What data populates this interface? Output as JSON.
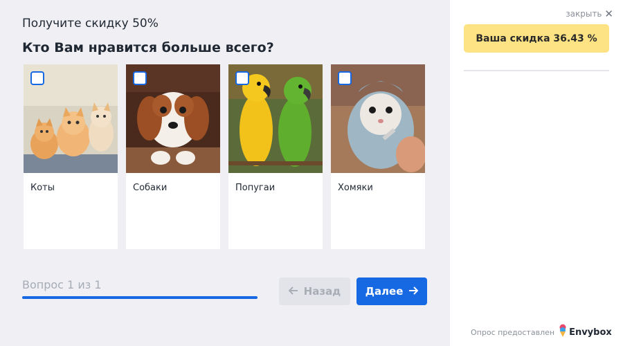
{
  "survey": {
    "subtitle": "Получите скидку 50%",
    "question": "Кто Вам нравится больше всего?",
    "options": [
      {
        "label": "Коты",
        "image_icon": "kittens-photo",
        "checked": false
      },
      {
        "label": "Собаки",
        "image_icon": "puppy-photo",
        "checked": false
      },
      {
        "label": "Попугаи",
        "image_icon": "parrots-photo",
        "checked": false
      },
      {
        "label": "Хомяки",
        "image_icon": "hamster-photo",
        "checked": false
      }
    ],
    "progress_text": "Вопрос 1 из 1",
    "progress_fraction": 1.0,
    "back_label": "Назад",
    "next_label": "Далее"
  },
  "sidebar": {
    "close_label": "закрыть",
    "discount_label": "Ваша скидка 36.43 %",
    "footer_text": "Опрос предоставлен",
    "brand_name": "Envybox"
  },
  "colors": {
    "accent": "#1668e3",
    "discount_bg": "#fde383",
    "background": "#f0f0f4"
  }
}
